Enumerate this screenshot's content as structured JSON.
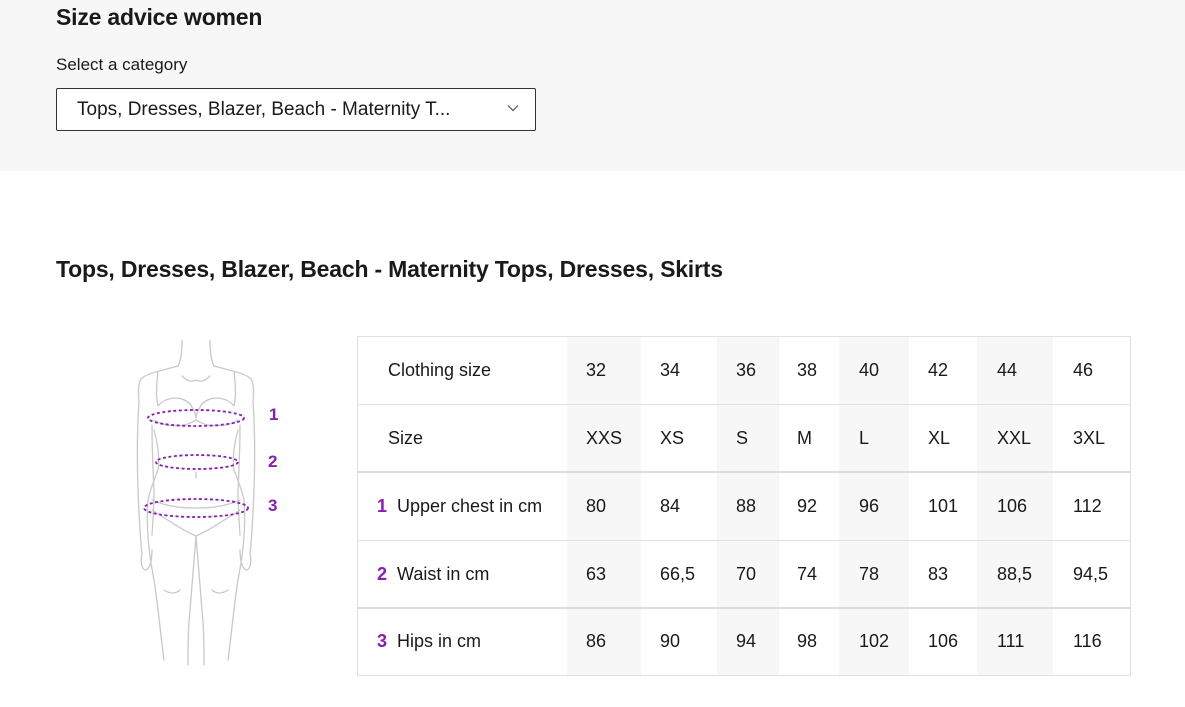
{
  "header": {
    "title": "Size advice women",
    "select_label": "Select a category",
    "select_value": "Tops, Dresses, Blazer, Beach - Maternity T...",
    "select_icon": "chevron-down-icon"
  },
  "section": {
    "title": "Tops, Dresses, Blazer, Beach - Maternity Tops, Dresses, Skirts"
  },
  "figure": {
    "markers": [
      "1",
      "2",
      "3"
    ],
    "accent_color": "#8a1bb5"
  },
  "table": {
    "rows": [
      {
        "num": "",
        "label": "Clothing size",
        "values": [
          "32",
          "34",
          "36",
          "38",
          "40",
          "42",
          "44",
          "46"
        ]
      },
      {
        "num": "",
        "label": "Size",
        "values": [
          "XXS",
          "XS",
          "S",
          "M",
          "L",
          "XL",
          "XXL",
          "3XL"
        ]
      },
      {
        "num": "1",
        "label": "Upper chest in cm",
        "values": [
          "80",
          "84",
          "88",
          "92",
          "96",
          "101",
          "106",
          "112"
        ]
      },
      {
        "num": "2",
        "label": "Waist in cm",
        "values": [
          "63",
          "66,5",
          "70",
          "74",
          "78",
          "83",
          "88,5",
          "94,5"
        ]
      },
      {
        "num": "3",
        "label": "Hips in cm",
        "values": [
          "86",
          "90",
          "94",
          "98",
          "102",
          "106",
          "111",
          "116"
        ]
      }
    ]
  }
}
